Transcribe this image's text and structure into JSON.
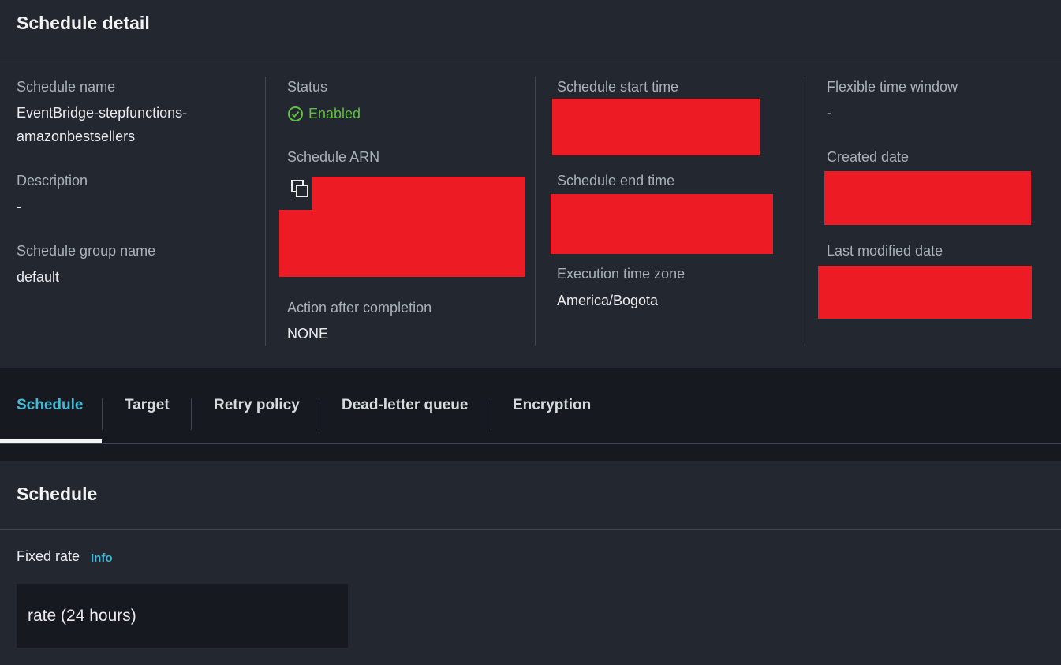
{
  "detail": {
    "title": "Schedule detail",
    "schedule_name_label": "Schedule name",
    "schedule_name_line1": "EventBridge-stepfunctions-",
    "schedule_name_line2": "amazonbestsellers",
    "description_label": "Description",
    "description_value": "-",
    "group_label": "Schedule group name",
    "group_value": "default",
    "status_label": "Status",
    "status_value": "Enabled",
    "arn_label": "Schedule ARN",
    "action_label": "Action after completion",
    "action_value": "NONE",
    "start_label": "Schedule start time",
    "end_label": "Schedule end time",
    "timezone_label": "Execution time zone",
    "timezone_value": "America/Bogota",
    "flex_label": "Flexible time window",
    "flex_value": "-",
    "created_label": "Created date",
    "modified_label": "Last modified date"
  },
  "tabs": [
    {
      "label": "Schedule",
      "active": true
    },
    {
      "label": "Target"
    },
    {
      "label": "Retry policy"
    },
    {
      "label": "Dead-letter queue"
    },
    {
      "label": "Encryption"
    }
  ],
  "schedule_section": {
    "title": "Schedule",
    "field_label": "Fixed rate",
    "info_label": "Info",
    "rate_value": "rate (24 hours)"
  },
  "colors": {
    "panel": "#232830",
    "background": "#161a20",
    "status_green": "#5fbf3f",
    "link_blue": "#44b9d6",
    "redaction": "#ed1c24"
  },
  "icons": {
    "status": "check-circle-icon",
    "copy": "copy-icon"
  }
}
